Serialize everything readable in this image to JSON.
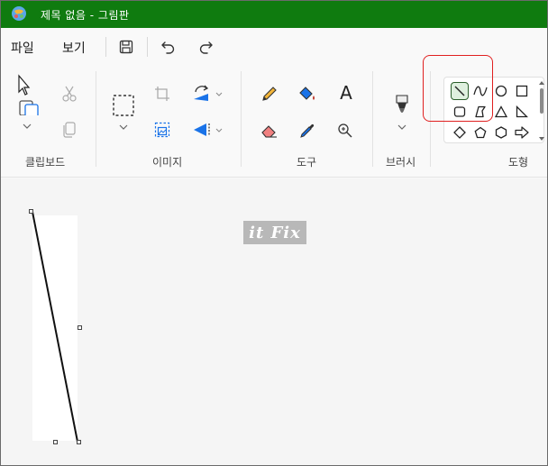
{
  "window": {
    "title": "제목 없음 - 그림판"
  },
  "menu": {
    "file_label": "파일",
    "view_label": "보기",
    "save_icon": "save-icon",
    "undo_icon": "undo-icon",
    "redo_icon": "redo-icon"
  },
  "ribbon": {
    "groups": {
      "clipboard_label": "클립보드",
      "image_label": "이미지",
      "tools_label": "도구",
      "brushes_label": "브러시",
      "shapes_label": "도형"
    },
    "tools": {
      "text_glyph": "A"
    },
    "shapes": {
      "selected": "line"
    }
  },
  "canvas": {
    "watermark_text": "it Fix"
  },
  "colors": {
    "titlebar": "#0f7b0f",
    "highlight": "#e02020",
    "accent_blue": "#1a73e8"
  }
}
